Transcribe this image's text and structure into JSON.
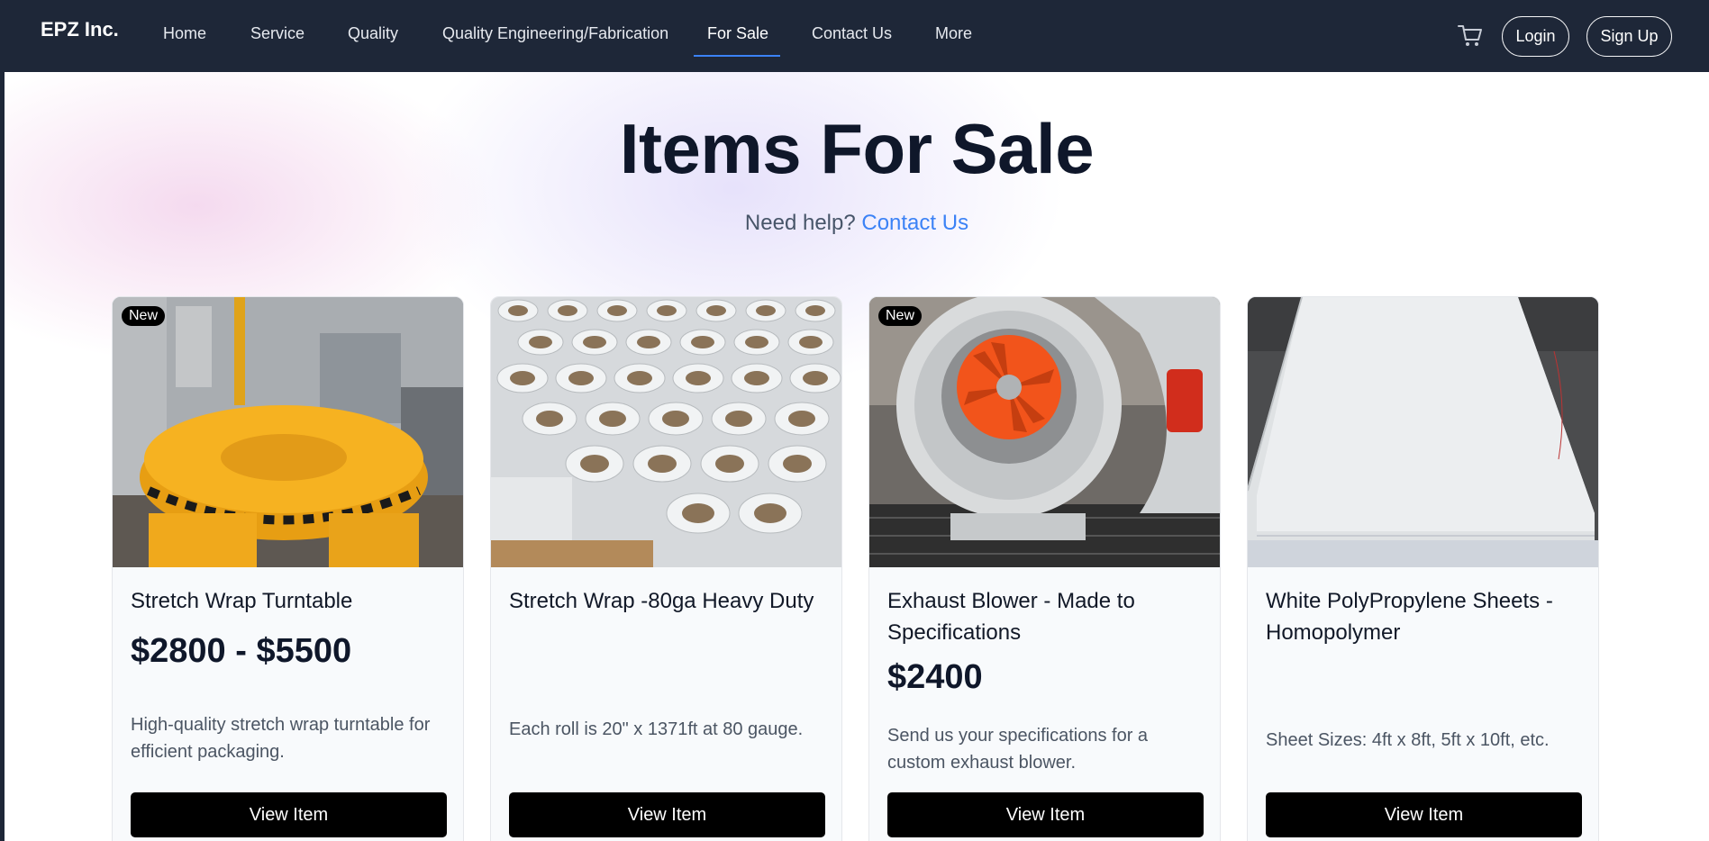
{
  "nav": {
    "brand": "EPZ Inc.",
    "items": [
      {
        "label": "Home"
      },
      {
        "label": "Service"
      },
      {
        "label": "Quality"
      },
      {
        "label": "Quality Engineering/Fabrication"
      },
      {
        "label": "For Sale",
        "active": true
      },
      {
        "label": "Contact Us"
      },
      {
        "label": "More"
      }
    ],
    "cart_icon": "shopping-cart-icon",
    "login_label": "Login",
    "signup_label": "Sign Up"
  },
  "hero": {
    "title": "Items For Sale",
    "help_text": "Need help?",
    "help_link": "Contact Us"
  },
  "products": [
    {
      "badge": "New",
      "title": "Stretch Wrap Turntable",
      "price": "$2800 - $5500",
      "description": "High-quality stretch wrap turntable for efficient packaging.",
      "button_label": "View Item"
    },
    {
      "badge": "",
      "title": "Stretch Wrap -80ga Heavy Duty",
      "price": "",
      "description": "Each roll is 20\" x 1371ft at 80 gauge.",
      "button_label": "View Item"
    },
    {
      "badge": "New",
      "title": "Exhaust Blower - Made to Specifications",
      "price": "$2400",
      "description": "Send us your specifications for a custom exhaust blower.",
      "button_label": "View Item"
    },
    {
      "badge": "",
      "title": "White PolyPropylene Sheets - Homopolymer",
      "price": "",
      "description": "Sheet Sizes: 4ft x 8ft, 5ft x 10ft, etc.",
      "button_label": "View Item"
    }
  ],
  "colors": {
    "nav_bg": "#1e2738",
    "accent": "#3b82f6",
    "button_bg": "#000000"
  }
}
